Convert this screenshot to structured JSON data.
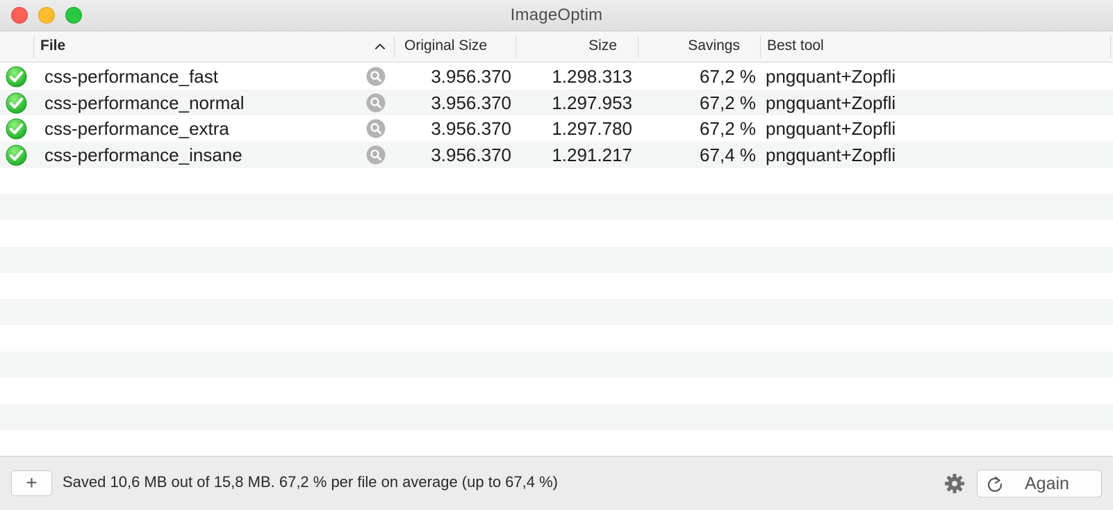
{
  "window": {
    "title": "ImageOptim"
  },
  "columns": {
    "file": "File",
    "original_size": "Original Size",
    "size": "Size",
    "savings": "Savings",
    "best_tool": "Best tool",
    "sort_icon": "chevron-up-icon"
  },
  "rows": [
    {
      "status_icon": "checkmark-circle-icon",
      "file": "css-performance_fast",
      "original_size": "3.956.370",
      "size": "1.298.313",
      "savings": "67,2 %",
      "best_tool": "pngquant+Zopfli"
    },
    {
      "status_icon": "checkmark-circle-icon",
      "file": "css-performance_normal",
      "original_size": "3.956.370",
      "size": "1.297.953",
      "savings": "67,2 %",
      "best_tool": "pngquant+Zopfli"
    },
    {
      "status_icon": "checkmark-circle-icon",
      "file": "css-performance_extra",
      "original_size": "3.956.370",
      "size": "1.297.780",
      "savings": "67,2 %",
      "best_tool": "pngquant+Zopfli"
    },
    {
      "status_icon": "checkmark-circle-icon",
      "file": "css-performance_insane",
      "original_size": "3.956.370",
      "size": "1.291.217",
      "savings": "67,4 %",
      "best_tool": "pngquant+Zopfli"
    }
  ],
  "footer": {
    "add_label": "+",
    "status": "Saved 10,6 MB out of 15,8 MB. 67,2 % per file on average (up to 67,4 %)",
    "settings_icon": "gear-icon",
    "again_label": "Again",
    "again_icon": "refresh-icon"
  },
  "colors": {
    "close": "#fe5f57",
    "minimize": "#febc2e",
    "maximize": "#28c840",
    "success": "#2fc23a",
    "row_stripe": "#f4f5f5"
  }
}
